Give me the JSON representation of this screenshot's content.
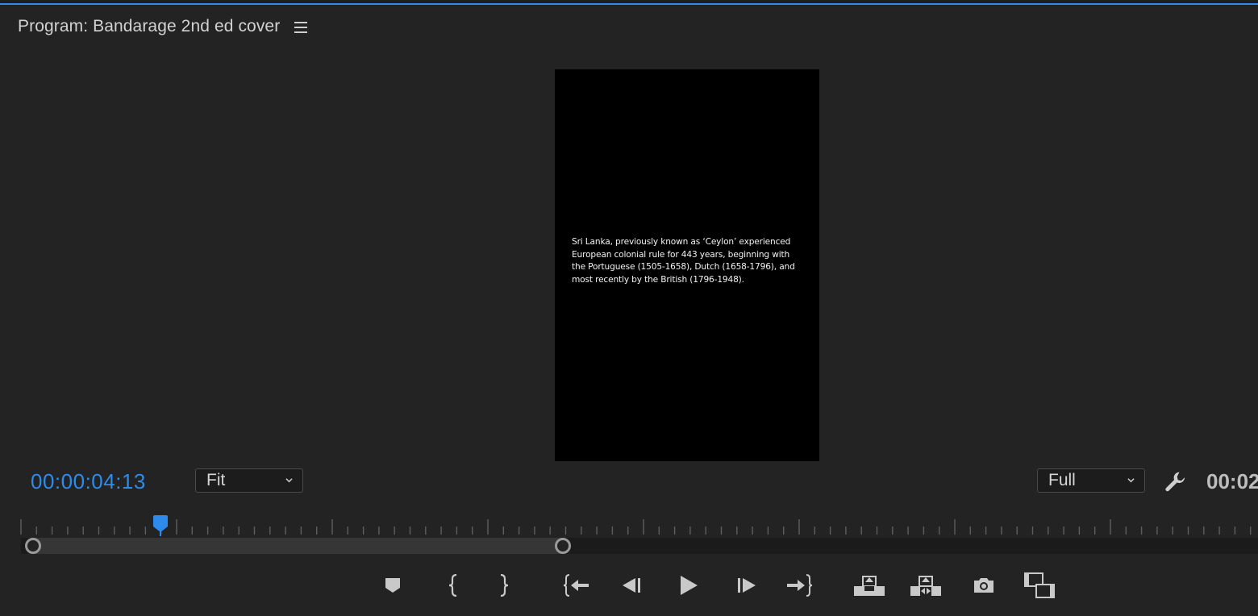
{
  "panel": {
    "title": "Program: Bandarage 2nd ed cover"
  },
  "viewer": {
    "frame_text": "Sri Lanka, previously known as ‘Ceylon’ experienced European colonial rule for 443 years, beginning with the Portuguese (1505-1658), Dutch (1658-1796), and most recently by the British (1796-1948)."
  },
  "controls": {
    "timecode": "00:00:04:13",
    "zoom_select": "Fit",
    "resolution_select": "Full",
    "duration_partial": "00:02"
  },
  "colors": {
    "accent": "#2d8ceb",
    "background": "#232323",
    "frame": "#000000"
  },
  "transport": [
    {
      "name": "add-marker-icon"
    },
    {
      "name": "mark-in-icon"
    },
    {
      "name": "mark-out-icon"
    },
    {
      "name": "go-to-in-icon"
    },
    {
      "name": "step-back-icon"
    },
    {
      "name": "play-icon"
    },
    {
      "name": "step-forward-icon"
    },
    {
      "name": "go-to-out-icon"
    },
    {
      "name": "lift-icon"
    },
    {
      "name": "extract-icon"
    },
    {
      "name": "export-frame-icon"
    },
    {
      "name": "comparison-view-icon"
    }
  ]
}
